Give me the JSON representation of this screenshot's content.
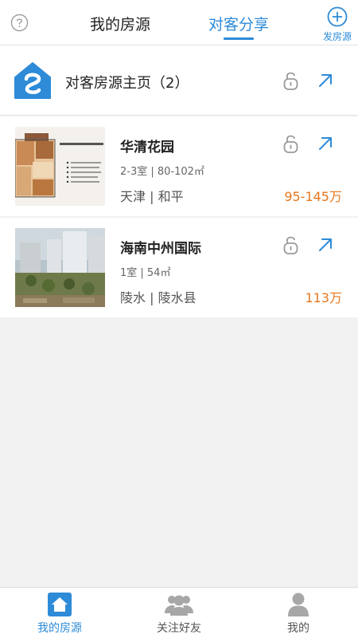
{
  "header": {
    "tab_mine": "我的房源",
    "tab_share": "对客分享",
    "post_label": "发房源",
    "help_icon": "question-circle-icon",
    "post_icon": "plus-circle-icon"
  },
  "homepage": {
    "title": "对客房源主页（2）",
    "logo_icon": "house-logo-icon"
  },
  "listings": [
    {
      "name": "华清花园",
      "spec": "2-3室 | 80-102㎡",
      "location": "天津 | 和平",
      "price": "95-145万"
    },
    {
      "name": "海南中州国际",
      "spec": "1室 | 54㎡",
      "location": "陵水 | 陵水县",
      "price": "113万"
    }
  ],
  "bottom_nav": [
    {
      "label": "我的房源",
      "icon": "house-icon",
      "active": true
    },
    {
      "label": "关注好友",
      "icon": "friends-icon",
      "active": false
    },
    {
      "label": "我的",
      "icon": "person-icon",
      "active": false
    }
  ],
  "colors": {
    "accent": "#2d8bd8",
    "price": "#e8771c"
  }
}
